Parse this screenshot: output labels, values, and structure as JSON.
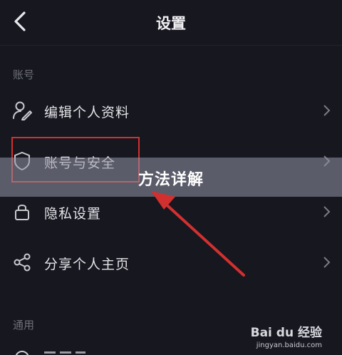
{
  "header": {
    "title": "设置",
    "back_icon": "back-icon"
  },
  "sections": {
    "account_label": "账号",
    "general_label": "通用"
  },
  "rows": [
    {
      "label": "编辑个人资料",
      "icon": "edit-profile-icon"
    },
    {
      "label": "账号与安全",
      "icon": "shield-icon"
    },
    {
      "label": "隐私设置",
      "icon": "lock-icon"
    },
    {
      "label": "分享个人主页",
      "icon": "share-icon"
    }
  ],
  "overlay": {
    "banner_text": "方法详解",
    "highlight_color": "#d2302f"
  },
  "watermark": {
    "logo": "Bai du 经验",
    "url": "jingyan.baidu.com"
  },
  "colors": {
    "background": "#16171f",
    "text": "#e3e3e7",
    "muted": "#6f7078",
    "accent_red": "#d2302f"
  }
}
